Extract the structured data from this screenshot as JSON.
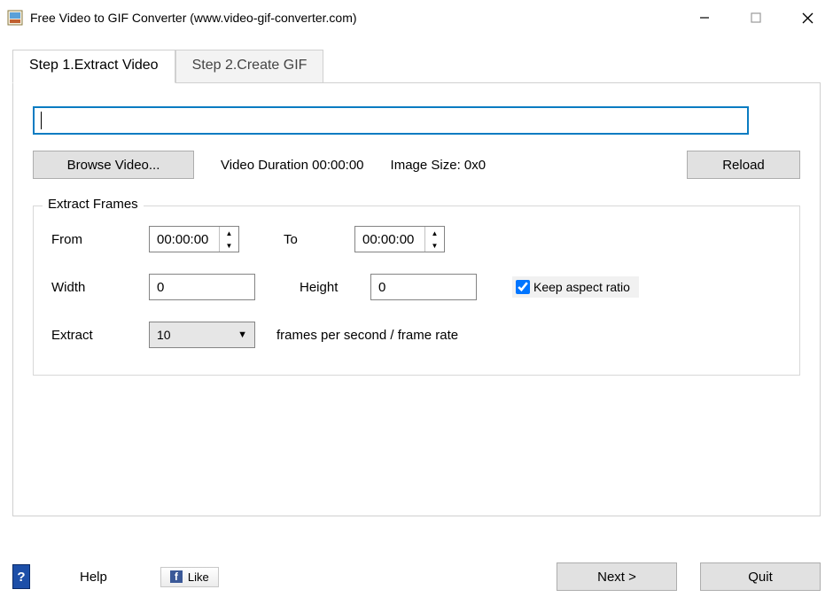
{
  "window": {
    "title": "Free Video to GIF Converter (www.video-gif-converter.com)"
  },
  "tabs": {
    "step1": "Step 1.Extract Video",
    "step2": "Step 2.Create GIF"
  },
  "main": {
    "path_value": "",
    "browse_label": "Browse Video...",
    "video_duration_label": "Video Duration",
    "video_duration_value": "00:00:00",
    "image_size_label": "Image Size:",
    "image_size_value": "0x0",
    "reload_label": "Reload"
  },
  "frames": {
    "legend": "Extract Frames",
    "from_label": "From",
    "from_value": "00:00:00",
    "to_label": "To",
    "to_value": "00:00:00",
    "width_label": "Width",
    "width_value": "0",
    "height_label": "Height",
    "height_value": "0",
    "keep_aspect_label": "Keep aspect ratio",
    "keep_aspect_checked": true,
    "extract_label": "Extract",
    "fps_value": "10",
    "fps_suffix": "frames per second / frame rate"
  },
  "footer": {
    "help_label": "Help",
    "like_label": "Like",
    "next_label": "Next >",
    "quit_label": "Quit"
  }
}
